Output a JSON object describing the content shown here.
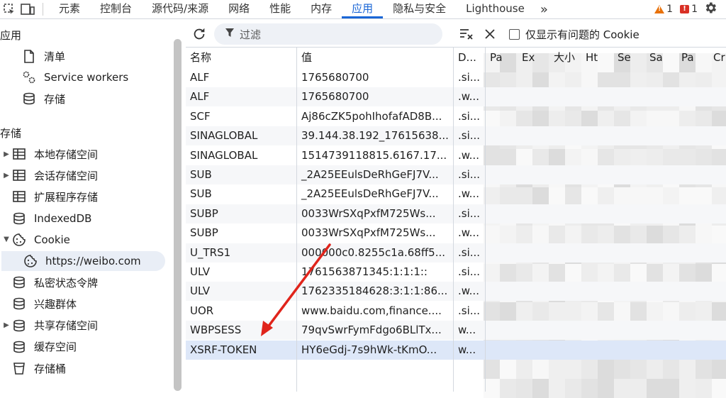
{
  "tabs": {
    "items": [
      "元素",
      "控制台",
      "源代码/来源",
      "网络",
      "性能",
      "内存",
      "应用",
      "隐私与安全",
      "Lighthouse"
    ],
    "active_index": 6,
    "more": "»",
    "warnings_count": "1",
    "errors_count": "1"
  },
  "sidebar": {
    "app_section": "应用",
    "app_items": [
      {
        "label": "清单",
        "icon": "document-icon"
      },
      {
        "label": "Service workers",
        "icon": "gears-icon"
      },
      {
        "label": "存储",
        "icon": "database-icon"
      }
    ],
    "storage_section": "存储",
    "storage_items": [
      {
        "label": "本地存储空间",
        "icon": "table-icon",
        "expander": "collapsed"
      },
      {
        "label": "会话存储空间",
        "icon": "table-icon",
        "expander": "collapsed"
      },
      {
        "label": "扩展程序存储",
        "icon": "table-icon",
        "expander": "none"
      },
      {
        "label": "IndexedDB",
        "icon": "database-icon",
        "expander": "none"
      },
      {
        "label": "Cookie",
        "icon": "cookie-icon",
        "expander": "expanded"
      },
      {
        "label": "https://weibo.com",
        "icon": "cookie-icon",
        "expander": "child",
        "selected": true
      },
      {
        "label": "私密状态令牌",
        "icon": "database-icon",
        "expander": "none"
      },
      {
        "label": "兴趣群体",
        "icon": "database-icon",
        "expander": "none"
      },
      {
        "label": "共享存储空间",
        "icon": "database-icon",
        "expander": "collapsed"
      },
      {
        "label": "缓存空间",
        "icon": "database-icon",
        "expander": "none"
      },
      {
        "label": "存储桶",
        "icon": "bucket-icon",
        "expander": "none"
      }
    ]
  },
  "toolbar": {
    "filter_placeholder": "过滤",
    "only_issues_label": "仅显示有问题的 Cookie"
  },
  "table": {
    "headers": [
      "名称",
      "值",
      "D...",
      "Pa",
      "Ex",
      "大小",
      "Ht",
      "Se",
      "Sa",
      "Pa",
      "Cr"
    ],
    "rows": [
      {
        "name": "ALF",
        "value": "1765680700",
        "domain": ".si..."
      },
      {
        "name": "ALF",
        "value": "1765680700",
        "domain": ".w..."
      },
      {
        "name": "SCF",
        "value": "Aj86cZK5pohIhofafAD8B...",
        "domain": ".si..."
      },
      {
        "name": "SINAGLOBAL",
        "value": "39.144.38.192_17615638...",
        "domain": ".si..."
      },
      {
        "name": "SINAGLOBAL",
        "value": "1514739118815.6167.17...",
        "domain": ".w..."
      },
      {
        "name": "SUB",
        "value": "_2A25EEulsDeRhGeFJ7V...",
        "domain": ".si..."
      },
      {
        "name": "SUB",
        "value": "_2A25EEulsDeRhGeFJ7V...",
        "domain": ".w..."
      },
      {
        "name": "SUBP",
        "value": "0033WrSXqPxfM725Ws...",
        "domain": ".si..."
      },
      {
        "name": "SUBP",
        "value": "0033WrSXqPxfM725Ws...",
        "domain": ".w..."
      },
      {
        "name": "U_TRS1",
        "value": "000000c0.8255c1a.68ff5...",
        "domain": ".si..."
      },
      {
        "name": "ULV",
        "value": "1761563871345:1:1:1::",
        "domain": ".si..."
      },
      {
        "name": "ULV",
        "value": "1762335184628:3:1:1:86...",
        "domain": ".w..."
      },
      {
        "name": "UOR",
        "value": "www.baidu.com,finance....",
        "domain": ".si..."
      },
      {
        "name": "WBPSESS",
        "value": "79qvSwrFymFdgo6BLlTx...",
        "domain": "w..."
      },
      {
        "name": "XSRF-TOKEN",
        "value": "HY6eGdj-7s9hWk-tKmO...",
        "domain": "w...",
        "selected": true
      }
    ]
  },
  "colors": {
    "accent": "#1a66d6",
    "annotation_arrow": "#e0241b",
    "selected_row": "#dde7f8"
  }
}
